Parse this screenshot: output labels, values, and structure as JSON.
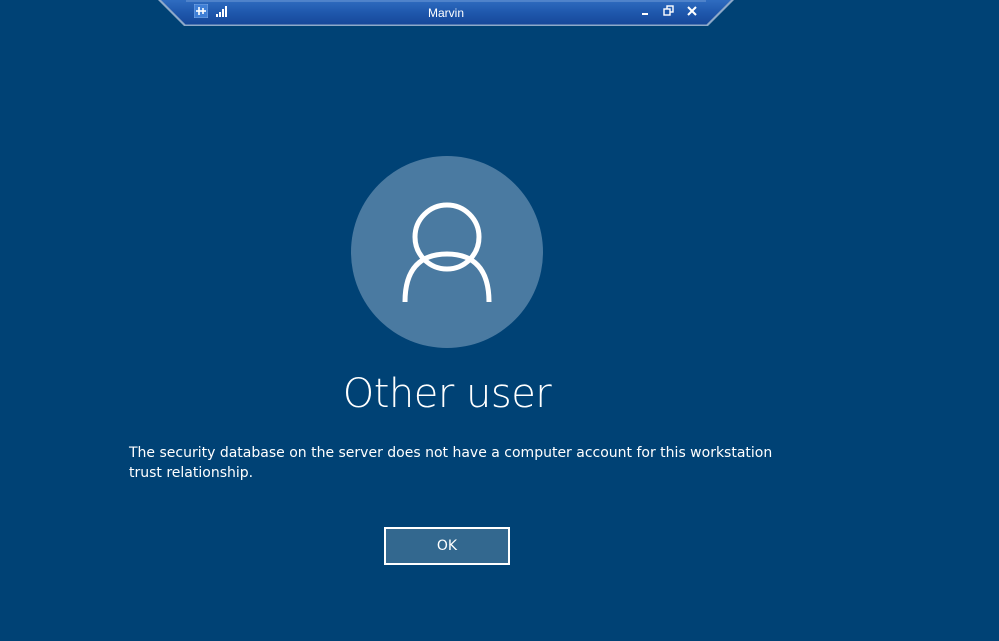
{
  "connection_bar": {
    "title": "Marvin",
    "icons": {
      "pin": "pin-icon",
      "signal": "signal-icon",
      "minimize": "minimize-icon",
      "restore": "restore-icon",
      "close": "close-icon"
    }
  },
  "login": {
    "avatar": "user-icon",
    "user_name": "Other user",
    "message": "The security database on the server does not have a computer account for this workstation trust relationship.",
    "ok_label": "OK"
  },
  "colors": {
    "background": "#004275",
    "avatar_bg": "#4a7aa1",
    "button_bg": "#33688f"
  }
}
